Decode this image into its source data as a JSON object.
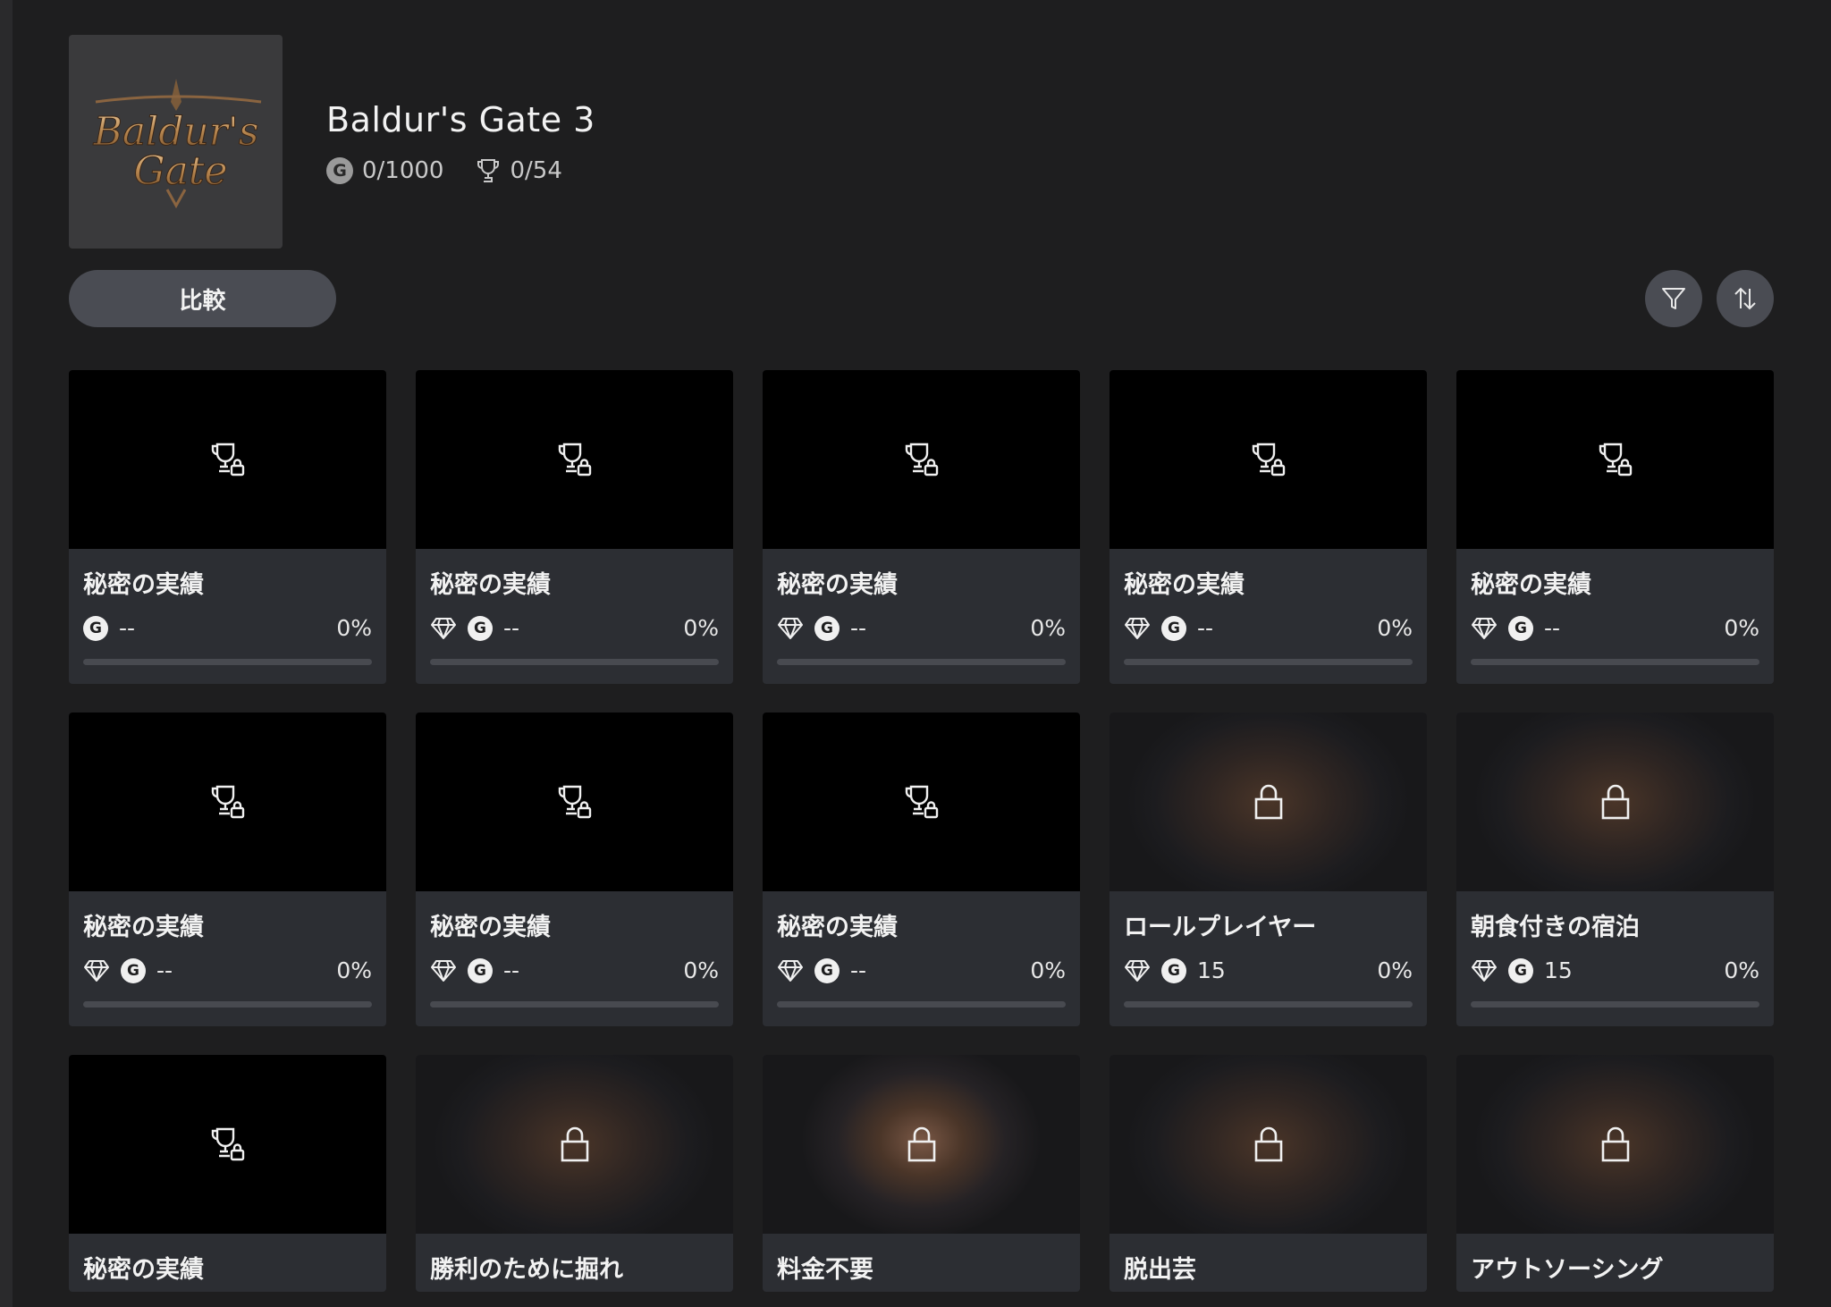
{
  "game": {
    "title": "Baldur's Gate 3",
    "logo_text_line1": "Baldur's",
    "logo_text_line2": "Gate",
    "gamerscore": "0/1000",
    "achievements": "0/54",
    "gamerscore_icon": "g-badge-icon",
    "achievements_icon": "trophy-icon"
  },
  "toolbar": {
    "compare_label": "比較",
    "filter_icon": "filter-icon",
    "sort_icon": "sort-icon"
  },
  "g_letter": "G",
  "cards": [
    {
      "title": "秘密の実績",
      "points": "--",
      "percent": "0%",
      "progress": 0,
      "image": "secret",
      "rare": false
    },
    {
      "title": "秘密の実績",
      "points": "--",
      "percent": "0%",
      "progress": 0,
      "image": "secret",
      "rare": true
    },
    {
      "title": "秘密の実績",
      "points": "--",
      "percent": "0%",
      "progress": 0,
      "image": "secret",
      "rare": true
    },
    {
      "title": "秘密の実績",
      "points": "--",
      "percent": "0%",
      "progress": 0,
      "image": "secret",
      "rare": true
    },
    {
      "title": "秘密の実績",
      "points": "--",
      "percent": "0%",
      "progress": 0,
      "image": "secret",
      "rare": true
    },
    {
      "title": "秘密の実績",
      "points": "--",
      "percent": "0%",
      "progress": 0,
      "image": "secret",
      "rare": true
    },
    {
      "title": "秘密の実績",
      "points": "--",
      "percent": "0%",
      "progress": 0,
      "image": "secret",
      "rare": true
    },
    {
      "title": "秘密の実績",
      "points": "--",
      "percent": "0%",
      "progress": 0,
      "image": "secret",
      "rare": true
    },
    {
      "title": "ロールプレイヤー",
      "points": "15",
      "percent": "0%",
      "progress": 0,
      "image": "art",
      "rare": true
    },
    {
      "title": "朝食付きの宿泊",
      "points": "15",
      "percent": "0%",
      "progress": 0,
      "image": "art",
      "rare": true
    },
    {
      "title": "秘密の実績",
      "image": "secret"
    },
    {
      "title": "勝利のために掘れ",
      "image": "art"
    },
    {
      "title": "料金不要",
      "image": "art-bright"
    },
    {
      "title": "脱出芸",
      "image": "art"
    },
    {
      "title": "アウトソーシング",
      "image": "art"
    }
  ],
  "colors": {
    "background": "#1e1e1f",
    "card": "#2c2e33",
    "button": "#4a4c53",
    "text": "#f2f2f2"
  }
}
